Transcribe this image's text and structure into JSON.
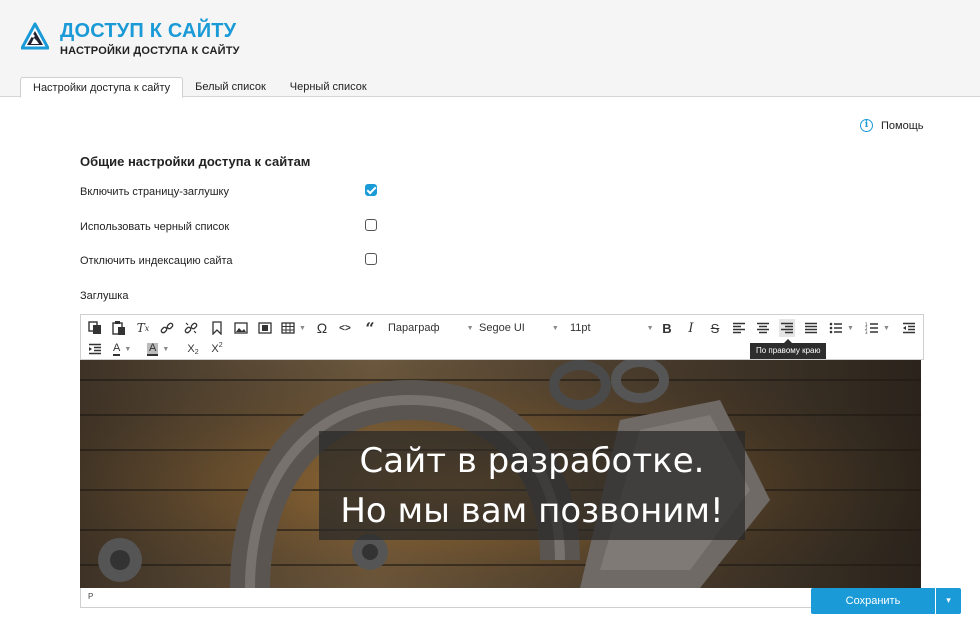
{
  "header": {
    "title": "ДОСТУП К САЙТУ",
    "subtitle": "НАСТРОЙКИ ДОСТУПА К САЙТУ"
  },
  "tabs": [
    {
      "label": "Настройки доступа к сайту",
      "active": true
    },
    {
      "label": "Белый список",
      "active": false
    },
    {
      "label": "Черный список",
      "active": false
    }
  ],
  "help": {
    "label": "Помощь",
    "icon": "info-icon"
  },
  "section": {
    "title": "Общие настройки доступа к сайтам"
  },
  "settings": [
    {
      "label": "Включить страницу-заглушку",
      "checked": true
    },
    {
      "label": "Использовать черный список",
      "checked": false
    },
    {
      "label": "Отключить индексацию сайта",
      "checked": false
    }
  ],
  "stub": {
    "label": "Заглушка"
  },
  "editor": {
    "format_value": "Параграф",
    "font_value": "Segoe UI",
    "size_value": "11pt",
    "tooltip": "По правому краю",
    "status_path": "P",
    "banner_line1": "Сайт в разработке.",
    "banner_line2": "Но мы вам позвоним!"
  },
  "actions": {
    "save_label": "Сохранить"
  },
  "colors": {
    "accent": "#1a9ad6"
  }
}
